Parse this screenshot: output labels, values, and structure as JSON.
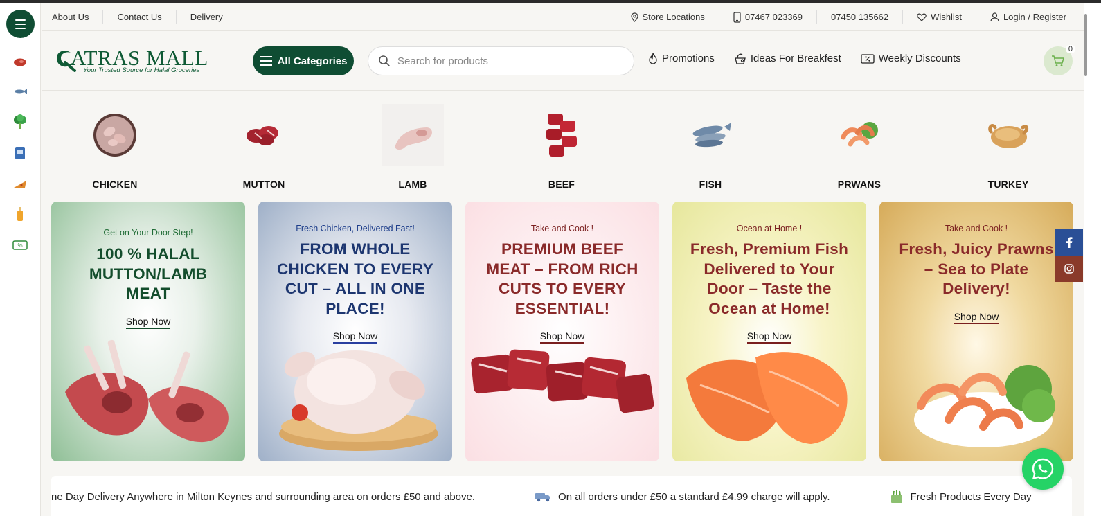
{
  "topbar": {
    "links": [
      "About Us",
      "Contact Us",
      "Delivery"
    ],
    "store_locations": "Store Locations",
    "phone_1": "07467 023369",
    "phone_2": "07450 135662",
    "wishlist": "Wishlist",
    "login": "Login / Register"
  },
  "header": {
    "logo_text": "ATRAS MALL",
    "logo_tagline": "Your Trusted Source for Halal Groceries",
    "all_categories": "All Categories",
    "search_placeholder": "Search for products",
    "nav": [
      "Promotions",
      "Ideas For Breakfest",
      "Weekly Discounts"
    ],
    "cart_count": "0"
  },
  "rail": {
    "icons": [
      "meat-icon",
      "fish-icon",
      "vegetable-icon",
      "grocery-icon",
      "snack-icon",
      "drink-icon",
      "discount-icon"
    ]
  },
  "categories": [
    "CHICKEN",
    "MUTTON",
    "LAMB",
    "BEEF",
    "FISH",
    "PRWANS",
    "TURKEY"
  ],
  "promos": [
    {
      "kicker": "Get on Your Door Step!",
      "headline": "100 % HALAL MUTTON/LAMB MEAT",
      "cta": "Shop Now"
    },
    {
      "kicker": "Fresh Chicken, Delivered Fast!",
      "headline": "FROM WHOLE CHICKEN TO EVERY CUT – ALL IN ONE PLACE!",
      "cta": "Shop Now"
    },
    {
      "kicker": "Take and Cook !",
      "headline": "PREMIUM BEEF MEAT – FROM RICH CUTS TO EVERY ESSENTIAL!",
      "cta": "Shop Now"
    },
    {
      "kicker": "Ocean at Home !",
      "headline": "Fresh, Premium Fish Delivered to Your Door – Taste the Ocean at Home!",
      "cta": "Shop Now"
    },
    {
      "kicker": "Take and Cook !",
      "headline": "Fresh, Juicy Prawns – Sea to Plate Delivery!",
      "cta": "Shop Now"
    }
  ],
  "ticker": [
    "ne Day Delivery Anywhere in Milton Keynes and surrounding area on orders £50 and above.",
    "On all orders under £50 a standard £4.99 charge will apply.",
    "Fresh Products Every Day"
  ],
  "colors": {
    "brand": "#0f4d33",
    "accent_red": "#8a2a2a",
    "cart_bg": "#dbe9cf",
    "whatsapp": "#25d366"
  }
}
